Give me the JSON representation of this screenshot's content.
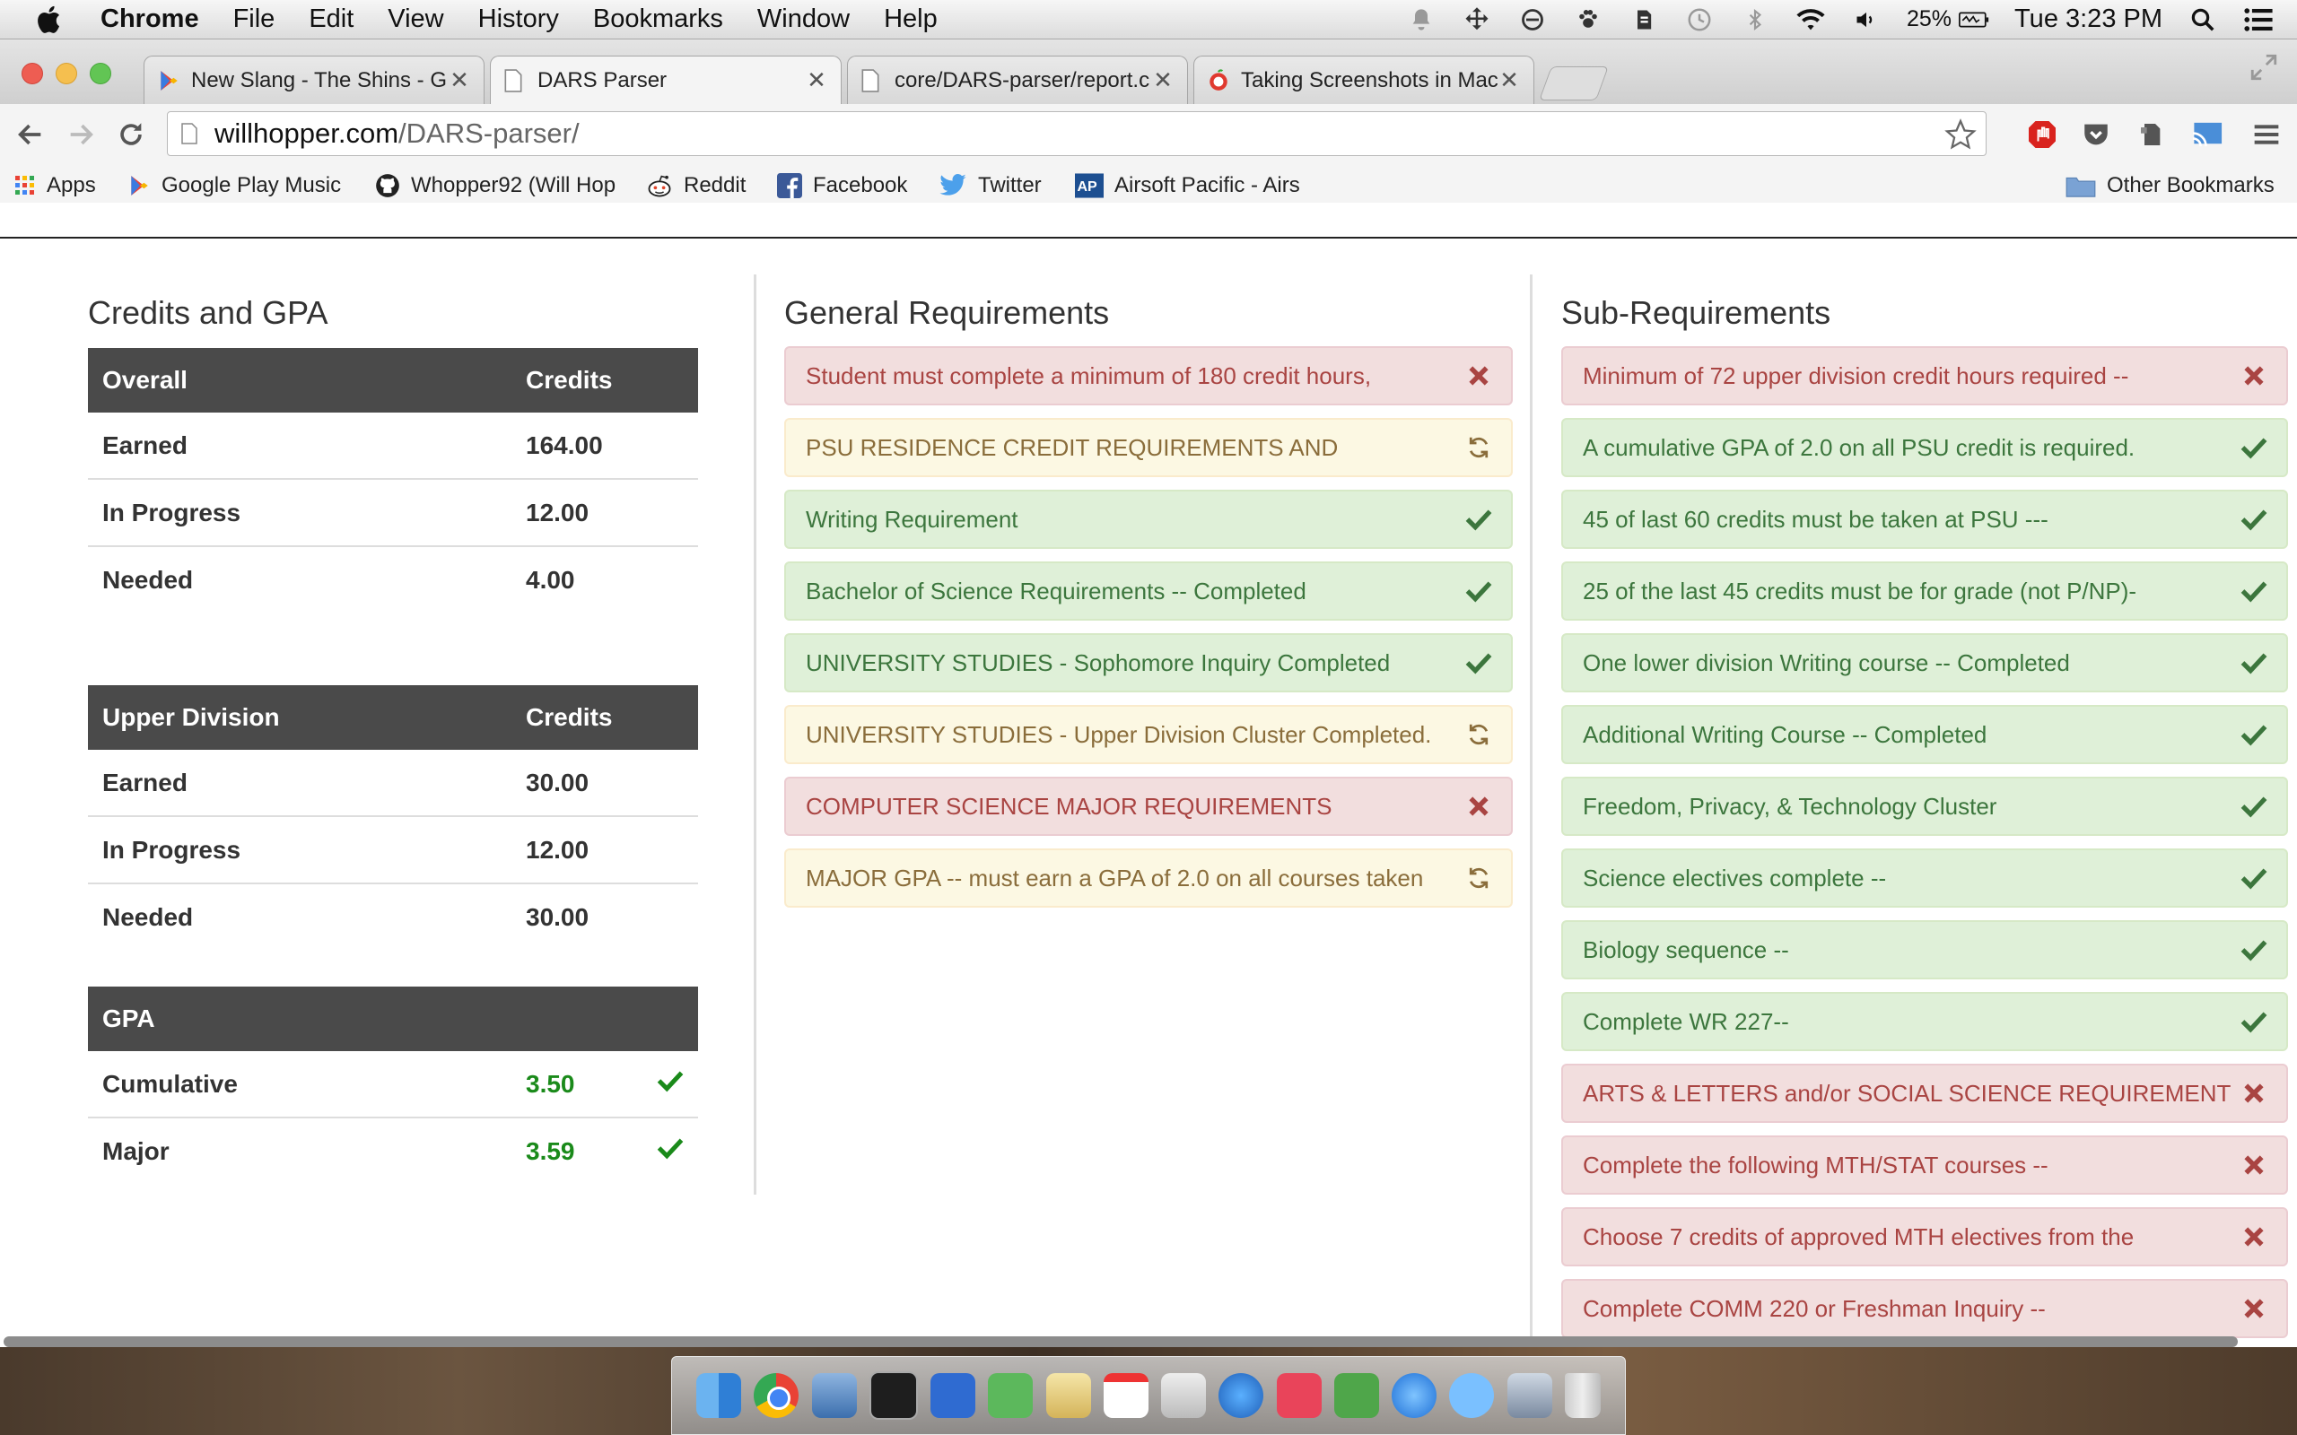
{
  "menubar": {
    "app": "Chrome",
    "items": [
      "File",
      "Edit",
      "View",
      "History",
      "Bookmarks",
      "Window",
      "Help"
    ],
    "battery": "25%",
    "clock": "Tue 3:23 PM"
  },
  "tabs": [
    {
      "title": "New Slang - The Shins - G",
      "icon": "google-play-icon",
      "active": false
    },
    {
      "title": "DARS Parser",
      "icon": "page-icon",
      "active": true
    },
    {
      "title": "core/DARS-parser/report.c",
      "icon": "page-icon",
      "active": false
    },
    {
      "title": "Taking Screenshots in Mac",
      "icon": "apple-icon",
      "active": false
    }
  ],
  "omnibox": {
    "host": "willhopper.com",
    "path": "/DARS-parser/"
  },
  "bookmarks": {
    "items": [
      "Apps",
      "Google Play Music",
      "Whopper92 (Will Hop",
      "Reddit",
      "Facebook",
      "Twitter",
      "Airsoft Pacific - Airs"
    ],
    "other": "Other Bookmarks"
  },
  "credits": {
    "title": "Credits and GPA",
    "overall": {
      "header": [
        "Overall",
        "Credits"
      ],
      "rows": [
        [
          "Earned",
          "164.00"
        ],
        [
          "In Progress",
          "12.00"
        ],
        [
          "Needed",
          "4.00"
        ]
      ]
    },
    "upper": {
      "header": [
        "Upper Division",
        "Credits"
      ],
      "rows": [
        [
          "Earned",
          "30.00"
        ],
        [
          "In Progress",
          "12.00"
        ],
        [
          "Needed",
          "30.00"
        ]
      ]
    },
    "gpa": {
      "header": "GPA",
      "rows": [
        [
          "Cumulative",
          "3.50"
        ],
        [
          "Major",
          "3.59"
        ]
      ]
    }
  },
  "general": {
    "title": "General Requirements",
    "items": [
      {
        "text": "Student must complete a minimum of 180 credit hours,",
        "status": "fail"
      },
      {
        "text": "PSU RESIDENCE CREDIT REQUIREMENTS AND",
        "status": "prog"
      },
      {
        "text": "Writing Requirement",
        "status": "done"
      },
      {
        "text": "Bachelor of Science Requirements -- Completed",
        "status": "done"
      },
      {
        "text": "UNIVERSITY STUDIES - Sophomore Inquiry Completed",
        "status": "done"
      },
      {
        "text": "UNIVERSITY STUDIES - Upper Division Cluster Completed.",
        "status": "prog"
      },
      {
        "text": "COMPUTER SCIENCE MAJOR REQUIREMENTS",
        "status": "fail"
      },
      {
        "text": "MAJOR GPA -- must earn a GPA of 2.0 on all courses taken",
        "status": "prog"
      }
    ]
  },
  "sub": {
    "title": "Sub-Requirements",
    "items": [
      {
        "text": "Minimum of 72 upper division credit hours required --",
        "status": "fail"
      },
      {
        "text": "A cumulative GPA of 2.0 on all PSU credit is required.",
        "status": "done"
      },
      {
        "text": "45 of last 60 credits must be taken at PSU ---",
        "status": "done"
      },
      {
        "text": "25 of the last 45 credits must be for grade (not P/NP)-",
        "status": "done"
      },
      {
        "text": "One lower division Writing course -- Completed",
        "status": "done"
      },
      {
        "text": "Additional Writing Course -- Completed",
        "status": "done"
      },
      {
        "text": "Freedom, Privacy, & Technology Cluster",
        "status": "done"
      },
      {
        "text": "Science electives complete --",
        "status": "done"
      },
      {
        "text": "Biology sequence --",
        "status": "done"
      },
      {
        "text": "Complete WR 227--",
        "status": "done"
      },
      {
        "text": "ARTS & LETTERS and/or SOCIAL SCIENCE REQUIREMENT",
        "status": "fail"
      },
      {
        "text": "Complete the following MTH/STAT courses --",
        "status": "fail"
      },
      {
        "text": "Choose 7 credits of approved MTH electives from the",
        "status": "fail"
      },
      {
        "text": "Complete COMM 220 or Freshman Inquiry --",
        "status": "fail"
      }
    ]
  },
  "colors": {
    "fail": "#a94442",
    "done": "#3c763d",
    "prog": "#8a6d3b",
    "header": "#4a4a4a"
  }
}
